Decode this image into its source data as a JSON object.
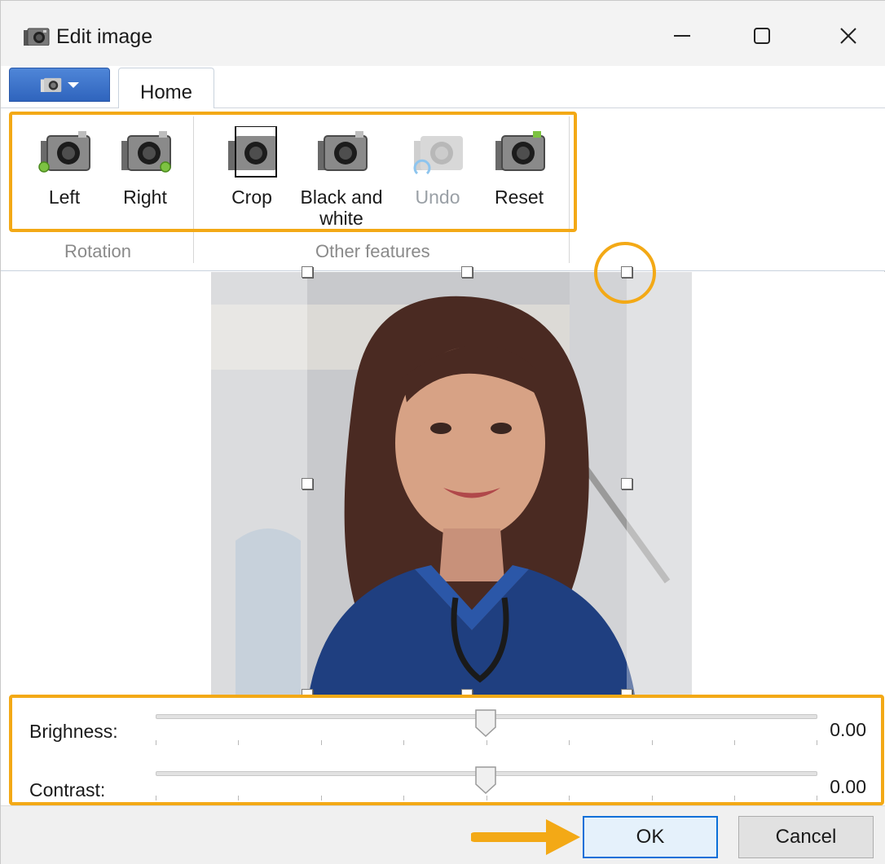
{
  "window": {
    "title": "Edit image",
    "icon": "camera-icon",
    "controls": [
      "minimize-icon",
      "maximize-icon",
      "close-icon"
    ]
  },
  "ribbon": {
    "app_menu_icon": "camera-icon",
    "tabs": [
      {
        "label": "Home",
        "active": true
      }
    ],
    "groups": [
      {
        "label": "Rotation",
        "buttons": [
          {
            "label": "Left",
            "icon": "rotate-left-camera-icon",
            "enabled": true
          },
          {
            "label": "Right",
            "icon": "rotate-right-camera-icon",
            "enabled": true
          }
        ]
      },
      {
        "label": "Other features",
        "buttons": [
          {
            "label": "Crop",
            "icon": "crop-camera-icon",
            "enabled": true,
            "active": true
          },
          {
            "label": "Black and white",
            "line1": "Black and",
            "line2": "white",
            "icon": "black-white-camera-icon",
            "enabled": true
          },
          {
            "label": "Undo",
            "icon": "undo-camera-icon",
            "enabled": false
          },
          {
            "label": "Reset",
            "icon": "reset-camera-icon",
            "enabled": true
          }
        ]
      }
    ]
  },
  "sliders": [
    {
      "label": "Brighness:",
      "value": "0.00",
      "position": 0.5
    },
    {
      "label": "Contrast:",
      "value": "0.00",
      "position": 0.5
    }
  ],
  "footer": {
    "ok_label": "OK",
    "cancel_label": "Cancel"
  },
  "colors": {
    "highlight": "#f3a916",
    "accent": "#0b6fd8",
    "app_menu": "#3a6fc6"
  }
}
